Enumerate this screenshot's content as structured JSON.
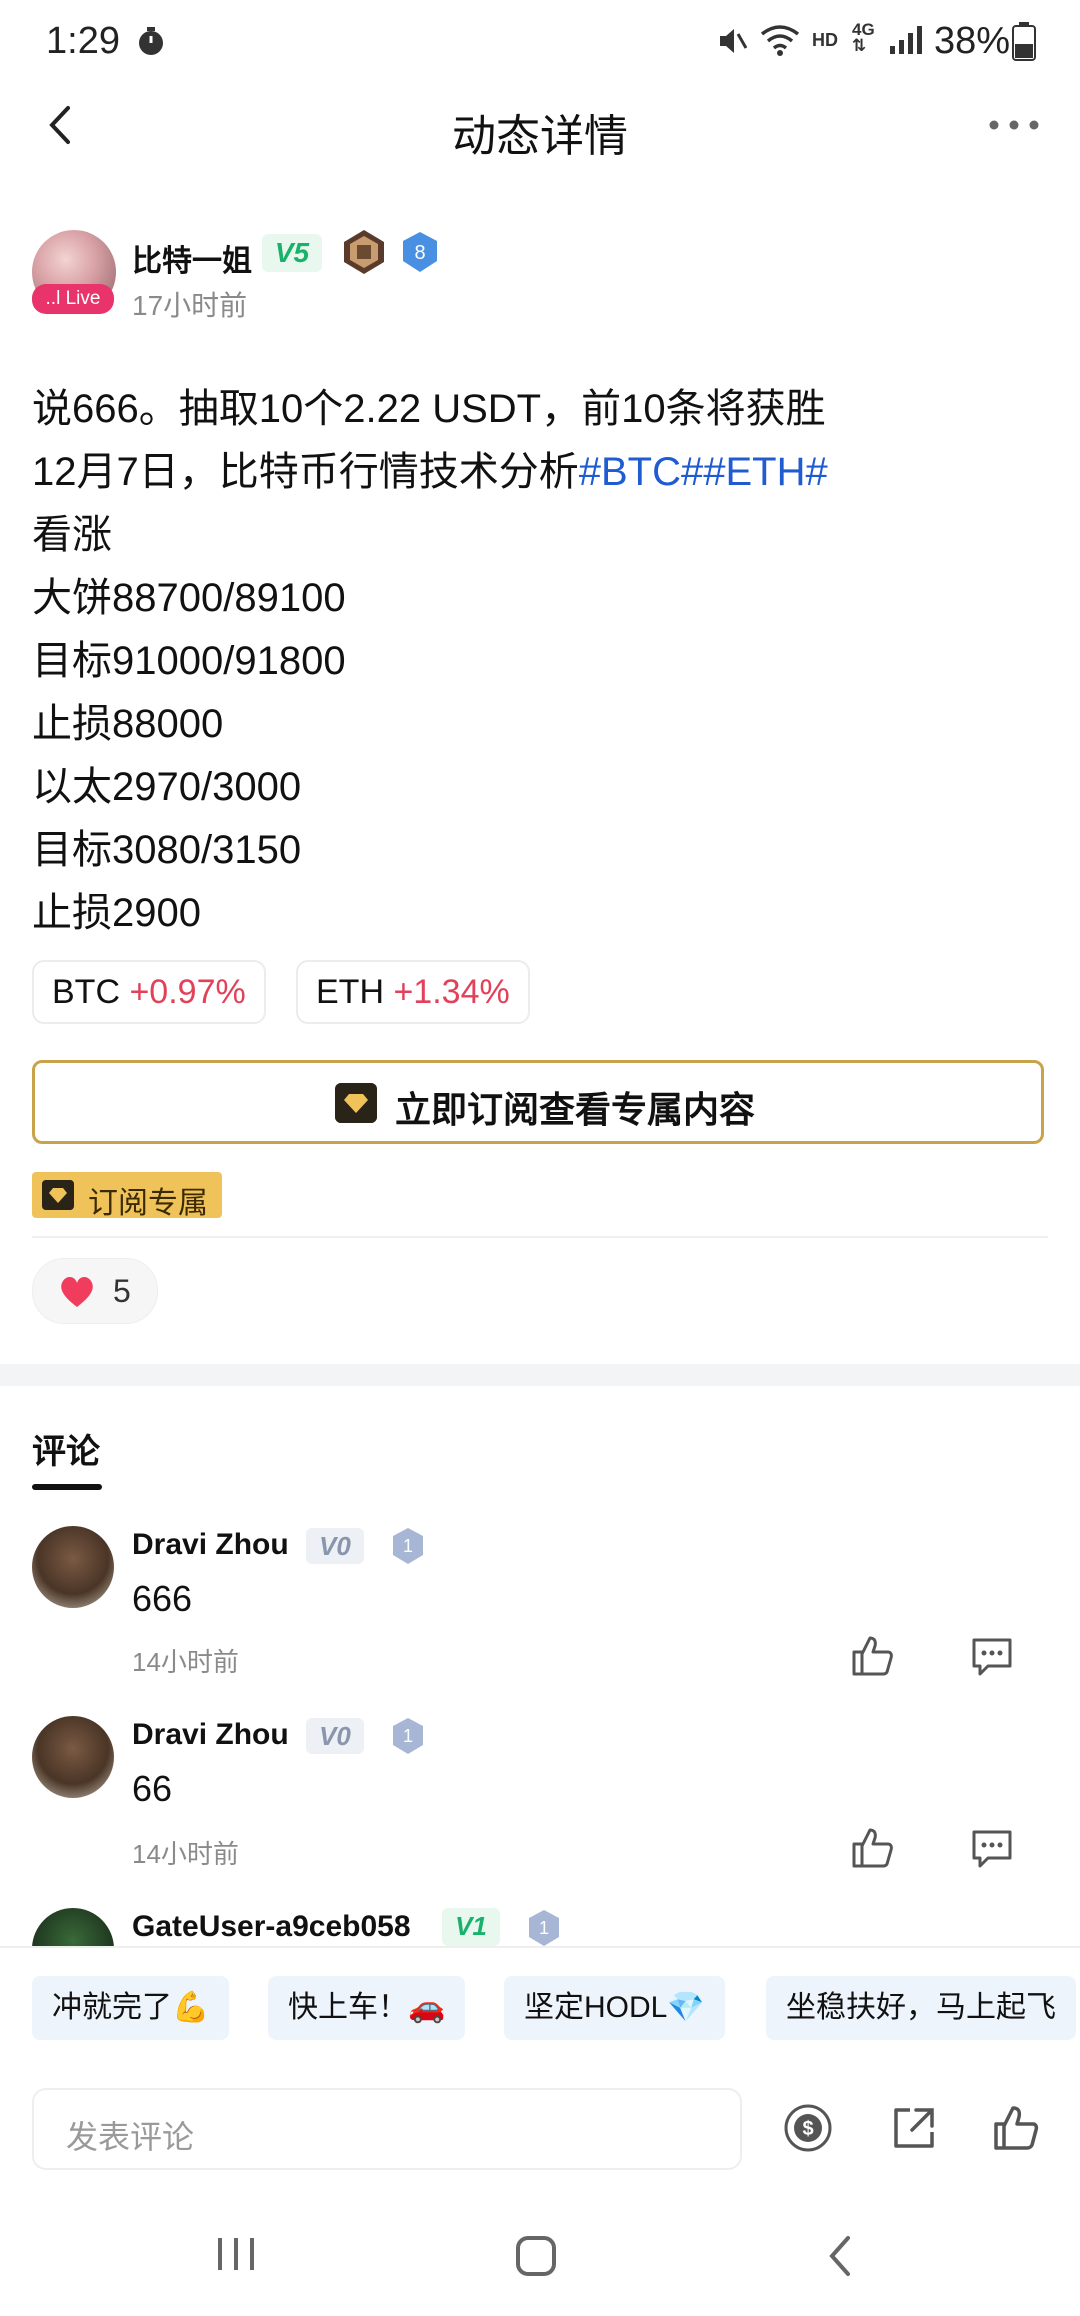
{
  "status_bar": {
    "time": "1:29",
    "battery": "38%"
  },
  "nav": {
    "title": "动态详情"
  },
  "author": {
    "name": "比特一姐",
    "level": "V5",
    "badge_num": "8",
    "live_label": "..l Live",
    "time": "17小时前"
  },
  "post": {
    "lines": [
      "说666。抽取10个2.22 USDT，前10条将获胜",
      "看涨",
      "大饼88700/89100",
      "目标91000/91800",
      "止损88000",
      "以太2970/3000",
      "目标3080/3150",
      "止损2900"
    ],
    "line2_prefix": "12月7日，比特币行情技术分析",
    "line2_tags": "#BTC##ETH#"
  },
  "coins": [
    {
      "symbol": "BTC",
      "change": "+0.97%"
    },
    {
      "symbol": "ETH",
      "change": "+1.34%"
    }
  ],
  "subscribe": {
    "button_label": "立即订阅查看专属内容",
    "tag_label": "订阅专属"
  },
  "likes": {
    "count": "5"
  },
  "comments": {
    "title": "评论",
    "items": [
      {
        "name": "Dravi Zhou",
        "level": "V0",
        "badge": "1",
        "text": "666",
        "time": "14小时前"
      },
      {
        "name": "Dravi Zhou",
        "level": "V0",
        "badge": "1",
        "text": "66",
        "time": "14小时前"
      },
      {
        "name": "GateUser-a9ceb058",
        "level": "V1",
        "badge": "1"
      }
    ]
  },
  "quick_replies": [
    "冲就完了💪",
    "快上车！🚗",
    "坚定HODL💎",
    "坐稳扶好，马上起飞"
  ],
  "input": {
    "placeholder": "发表评论"
  },
  "colors": {
    "accent_red": "#e2415a",
    "tag_blue": "#1f5bd1",
    "gold": "#c9a34a",
    "green": "#18b26b"
  }
}
